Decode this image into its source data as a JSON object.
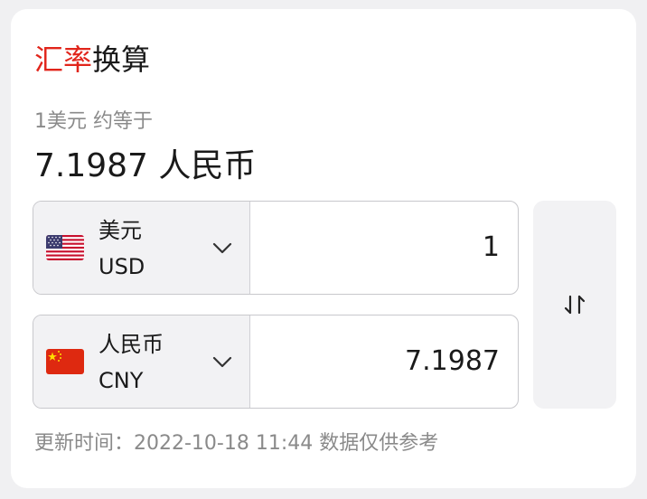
{
  "title": {
    "highlight": "汇率",
    "rest": "换算"
  },
  "subtitle": "1美元 约等于",
  "rate_text": "7.1987 人民币",
  "from": {
    "name": "美元",
    "code": "USD",
    "amount": "1",
    "flag_icon": "us-flag-icon"
  },
  "to": {
    "name": "人民币",
    "code": "CNY",
    "amount": "7.1987",
    "flag_icon": "cn-flag-icon"
  },
  "swap_icon": "swap-arrows-icon",
  "footer": "更新时间：2022-10-18 11:44 数据仅供参考",
  "colors": {
    "accent": "#e1251b",
    "muted_text": "#8a8a8a",
    "panel_bg": "#f2f2f4"
  }
}
